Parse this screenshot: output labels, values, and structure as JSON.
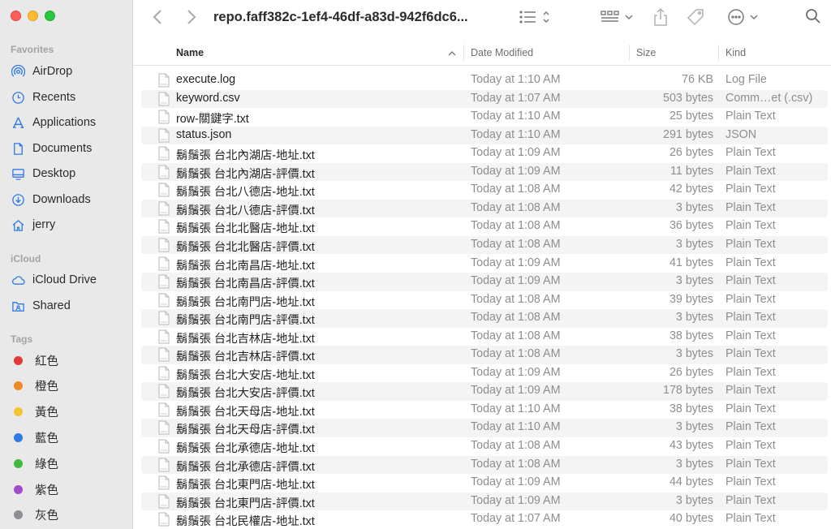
{
  "window": {
    "title": "repo.faff382c-1ef4-46df-a83d-942f6dc6..."
  },
  "sidebar": {
    "favorites_label": "Favorites",
    "favorites": [
      {
        "label": "AirDrop",
        "icon": "airdrop-icon"
      },
      {
        "label": "Recents",
        "icon": "clock-icon"
      },
      {
        "label": "Applications",
        "icon": "applications-icon"
      },
      {
        "label": "Documents",
        "icon": "document-icon"
      },
      {
        "label": "Desktop",
        "icon": "desktop-icon"
      },
      {
        "label": "Downloads",
        "icon": "download-icon"
      },
      {
        "label": "jerry",
        "icon": "home-icon"
      }
    ],
    "icloud_label": "iCloud",
    "icloud": [
      {
        "label": "iCloud Drive",
        "icon": "cloud-icon"
      },
      {
        "label": "Shared",
        "icon": "shared-folder-icon"
      }
    ],
    "tags_label": "Tags",
    "tags": [
      {
        "label": "紅色",
        "color": "#e5383b"
      },
      {
        "label": "橙色",
        "color": "#f08a24"
      },
      {
        "label": "黃色",
        "color": "#f4c430"
      },
      {
        "label": "藍色",
        "color": "#2f7ae5"
      },
      {
        "label": "綠色",
        "color": "#3dbb3d"
      },
      {
        "label": "紫色",
        "color": "#a24bc9"
      },
      {
        "label": "灰色",
        "color": "#8e8e93"
      }
    ]
  },
  "columns": {
    "name": "Name",
    "date": "Date Modified",
    "size": "Size",
    "kind": "Kind"
  },
  "files": [
    {
      "name": "execute.log",
      "date": "Today at 1:10 AM",
      "size": "76 KB",
      "kind": "Log File"
    },
    {
      "name": "keyword.csv",
      "date": "Today at 1:07 AM",
      "size": "503 bytes",
      "kind": "Comm…et (.csv)"
    },
    {
      "name": "row-關鍵字.txt",
      "date": "Today at 1:10 AM",
      "size": "25 bytes",
      "kind": "Plain Text"
    },
    {
      "name": "status.json",
      "date": "Today at 1:10 AM",
      "size": "291 bytes",
      "kind": "JSON"
    },
    {
      "name": "鬍鬚張 台北內湖店-地址.txt",
      "date": "Today at 1:09 AM",
      "size": "26 bytes",
      "kind": "Plain Text"
    },
    {
      "name": "鬍鬚張 台北內湖店-評價.txt",
      "date": "Today at 1:09 AM",
      "size": "11 bytes",
      "kind": "Plain Text"
    },
    {
      "name": "鬍鬚張 台北八德店-地址.txt",
      "date": "Today at 1:08 AM",
      "size": "42 bytes",
      "kind": "Plain Text"
    },
    {
      "name": "鬍鬚張 台北八德店-評價.txt",
      "date": "Today at 1:08 AM",
      "size": "3 bytes",
      "kind": "Plain Text"
    },
    {
      "name": "鬍鬚張 台北北醫店-地址.txt",
      "date": "Today at 1:08 AM",
      "size": "36 bytes",
      "kind": "Plain Text"
    },
    {
      "name": "鬍鬚張 台北北醫店-評價.txt",
      "date": "Today at 1:08 AM",
      "size": "3 bytes",
      "kind": "Plain Text"
    },
    {
      "name": "鬍鬚張 台北南昌店-地址.txt",
      "date": "Today at 1:09 AM",
      "size": "41 bytes",
      "kind": "Plain Text"
    },
    {
      "name": "鬍鬚張 台北南昌店-評價.txt",
      "date": "Today at 1:09 AM",
      "size": "3 bytes",
      "kind": "Plain Text"
    },
    {
      "name": "鬍鬚張 台北南門店-地址.txt",
      "date": "Today at 1:08 AM",
      "size": "39 bytes",
      "kind": "Plain Text"
    },
    {
      "name": "鬍鬚張 台北南門店-評價.txt",
      "date": "Today at 1:08 AM",
      "size": "3 bytes",
      "kind": "Plain Text"
    },
    {
      "name": "鬍鬚張 台北吉林店-地址.txt",
      "date": "Today at 1:08 AM",
      "size": "38 bytes",
      "kind": "Plain Text"
    },
    {
      "name": "鬍鬚張 台北吉林店-評價.txt",
      "date": "Today at 1:08 AM",
      "size": "3 bytes",
      "kind": "Plain Text"
    },
    {
      "name": "鬍鬚張 台北大安店-地址.txt",
      "date": "Today at 1:09 AM",
      "size": "26 bytes",
      "kind": "Plain Text"
    },
    {
      "name": "鬍鬚張 台北大安店-評價.txt",
      "date": "Today at 1:09 AM",
      "size": "178 bytes",
      "kind": "Plain Text"
    },
    {
      "name": "鬍鬚張 台北天母店-地址.txt",
      "date": "Today at 1:10 AM",
      "size": "38 bytes",
      "kind": "Plain Text"
    },
    {
      "name": "鬍鬚張 台北天母店-評價.txt",
      "date": "Today at 1:10 AM",
      "size": "3 bytes",
      "kind": "Plain Text"
    },
    {
      "name": "鬍鬚張 台北承德店-地址.txt",
      "date": "Today at 1:08 AM",
      "size": "43 bytes",
      "kind": "Plain Text"
    },
    {
      "name": "鬍鬚張 台北承德店-評價.txt",
      "date": "Today at 1:08 AM",
      "size": "3 bytes",
      "kind": "Plain Text"
    },
    {
      "name": "鬍鬚張 台北東門店-地址.txt",
      "date": "Today at 1:09 AM",
      "size": "44 bytes",
      "kind": "Plain Text"
    },
    {
      "name": "鬍鬚張 台北東門店-評價.txt",
      "date": "Today at 1:09 AM",
      "size": "3 bytes",
      "kind": "Plain Text"
    },
    {
      "name": "鬍鬚張 台北民權店-地址.txt",
      "date": "Today at 1:07 AM",
      "size": "40 bytes",
      "kind": "Plain Text"
    }
  ]
}
